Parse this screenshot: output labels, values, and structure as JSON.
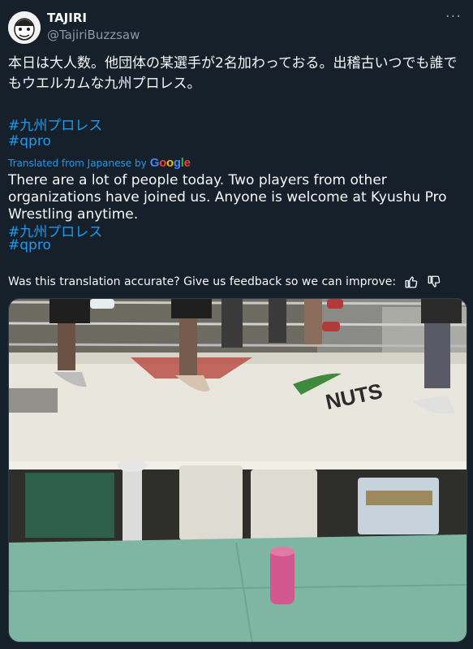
{
  "user": {
    "display_name": "TAJIRI",
    "handle": "@TajiriBuzzsaw",
    "avatar_icon": "avatar-caricature-icon"
  },
  "header": {
    "more_icon": "more-dots-icon",
    "more_label": "···"
  },
  "tweet": {
    "text": "本日は大人数。他団体の某選手が2名加わっておる。出稽古いつでも誰でもウエルカムな九州プロレス。",
    "hashtags": [
      "#九州プロレス",
      "#qpro"
    ]
  },
  "translation": {
    "label": "Translated from Japanese by",
    "provider": [
      "G",
      "o",
      "o",
      "g",
      "l",
      "e"
    ],
    "text": "There are a lot of people today. Two players from other organizations have joined us. Anyone is welcome at Kyushu Pro Wrestling anytime.",
    "hashtags": [
      "#九州プロレス",
      "#qpro"
    ]
  },
  "feedback": {
    "question": "Was this translation accurate? Give us feedback so we can improve:",
    "thumbs_up_icon": "thumbs-up-icon",
    "thumbs_down_icon": "thumbs-down-icon"
  },
  "media": {
    "description_icon": "wrestling-ring-photo",
    "ring_logo_text": "NUTS"
  },
  "colors": {
    "background": "#15202b",
    "link": "#1d9bf0",
    "secondary_text": "#8b98a5"
  }
}
